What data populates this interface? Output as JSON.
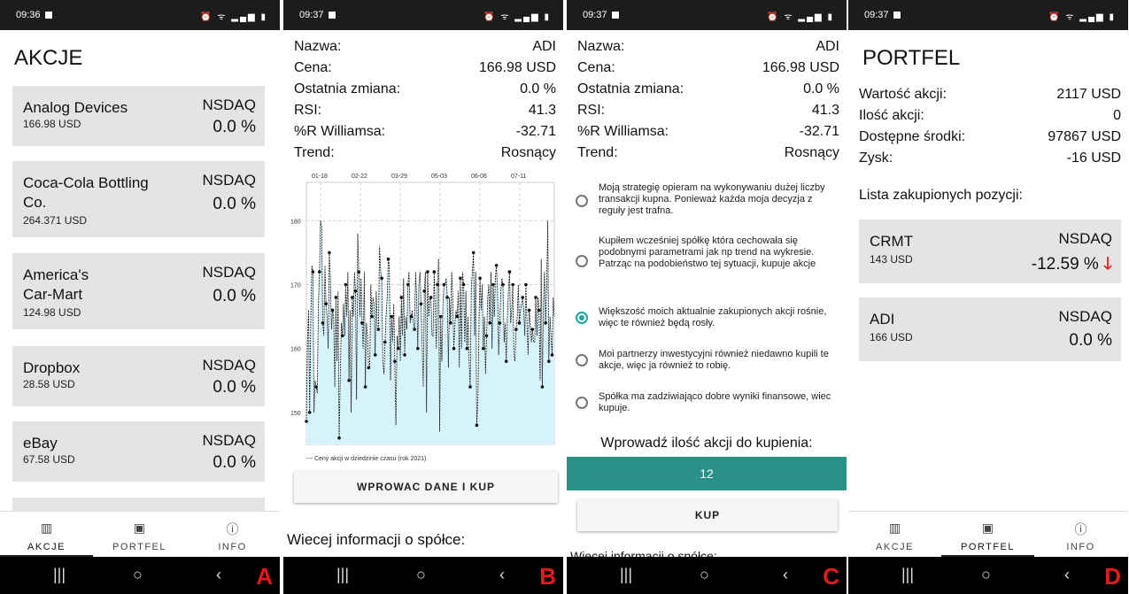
{
  "corners": [
    "A",
    "B",
    "C",
    "D"
  ],
  "status": {
    "a_time": "09:36",
    "b_time": "09:37",
    "c_time": "09:37",
    "d_time": "09:37",
    "icons": "⏰ ᯤ ▂▄▆ ▮"
  },
  "nav_icons": {
    "recent": "|||",
    "home": "○",
    "back": "‹"
  },
  "bottom_nav": [
    {
      "icon": "▥",
      "label": "AKCJE"
    },
    {
      "icon": "▣",
      "label": "PORTFEL"
    },
    {
      "icon": "ⓘ",
      "label": "INFO"
    }
  ],
  "screen_a": {
    "title": "AKCJE",
    "stocks": [
      {
        "name": "Analog Devices",
        "price": "166.98 USD",
        "exchange": "NSDAQ",
        "change": "0.0 %"
      },
      {
        "name": "Coca-Cola Bottling Co.",
        "price": "264.371 USD",
        "exchange": "NSDAQ",
        "change": "0.0 %"
      },
      {
        "name": "America's Car-Mart",
        "price": "124.98 USD",
        "exchange": "NSDAQ",
        "change": "0.0 %"
      },
      {
        "name": "Dropbox",
        "price": "28.58 USD",
        "exchange": "NSDAQ",
        "change": "0.0 %"
      },
      {
        "name": "eBay",
        "price": "67.58 USD",
        "exchange": "NSDAQ",
        "change": "0.0 %"
      }
    ]
  },
  "details": {
    "rows": [
      {
        "label": "Nazwa:",
        "value": "ADI"
      },
      {
        "label": "Cena:",
        "value": "166.98 USD"
      },
      {
        "label": "Ostatnia zmiana:",
        "value": "0.0 %"
      },
      {
        "label": "RSI:",
        "value": "41.3"
      },
      {
        "label": "%R Williamsa:",
        "value": "-32.71"
      },
      {
        "label": "Trend:",
        "value": "Rosnący"
      }
    ]
  },
  "screen_b": {
    "buy_button": "WPROWAC DANE I KUP",
    "more_info": "Wiecej informacji o spółce:"
  },
  "chart_data": {
    "type": "line",
    "x_ticks": [
      "01-18",
      "02-22",
      "03-29",
      "05-03",
      "06-06",
      "07-11"
    ],
    "y_ticks": [
      150,
      160,
      170,
      180
    ],
    "ylim": [
      145,
      186
    ],
    "legend": "--- Ceny akcji w dziedzinie czasu (rok 2021)",
    "fill_color": "#d6f3fb",
    "values": [
      148.6,
      161,
      166,
      150,
      164,
      173,
      172,
      150,
      155,
      154,
      153,
      167,
      172,
      180,
      179,
      164,
      162,
      173,
      167,
      165,
      160,
      175,
      171,
      163,
      166,
      165,
      154,
      168,
      158,
      169,
      146,
      155,
      164,
      162,
      167,
      162,
      170,
      165,
      172,
      155,
      166,
      150,
      168,
      165,
      172,
      169,
      152,
      178,
      172,
      165,
      171,
      164,
      160,
      172,
      154,
      164,
      162,
      157,
      157,
      170,
      165,
      168,
      167,
      159,
      169,
      163,
      163,
      176,
      172,
      171,
      158,
      156,
      161,
      165,
      168,
      174,
      173,
      155,
      165,
      161,
      167,
      158,
      148,
      162,
      160,
      165,
      158,
      168,
      162,
      171,
      159,
      165,
      163,
      170,
      172,
      164,
      165,
      166,
      164,
      163,
      172,
      168,
      160,
      170,
      172,
      167,
      161,
      154,
      169,
      172,
      150,
      172,
      165,
      168,
      168,
      162,
      162,
      172,
      166,
      160,
      170,
      174,
      147,
      165,
      158,
      167,
      170,
      170,
      171,
      168,
      157,
      168,
      164,
      172,
      168,
      160,
      164,
      166,
      165,
      169,
      157,
      171,
      160,
      172,
      170,
      161,
      169,
      160,
      165,
      158,
      154,
      170,
      172,
      175,
      162,
      172,
      148,
      152,
      164,
      171,
      166,
      170,
      160,
      165,
      156,
      162,
      168,
      170,
      164,
      172,
      160,
      170,
      165,
      171,
      173,
      169,
      159,
      164,
      169,
      171,
      170,
      161,
      164,
      158,
      165,
      169,
      172,
      164,
      166,
      170,
      159,
      158,
      163,
      165,
      170,
      164,
      166,
      167,
      168,
      166,
      162,
      170,
      164,
      159,
      166,
      164,
      161,
      163,
      161,
      161,
      168,
      162,
      168,
      166,
      155,
      174,
      154,
      167,
      172,
      164,
      170,
      180,
      158,
      165,
      162,
      159,
      168,
      165
    ]
  },
  "screen_c": {
    "options": [
      "Moją strategię opieram na wykonywaniu dużej liczby transakcji kupna. Ponieważ każda moja decyzja z reguły jest trafna.",
      "Kupiłem wcześniej spółkę która cechowała się podobnymi parametrami jak np trend na wykresie. Patrząc na podobieństwo tej sytuacji, kupuje akcje",
      "Większość moich aktualnie zakupionych akcji rośnie, więc te również będą rosły.",
      "Moi partnerzy inwestycyjni również niedawno kupili te akcje, więc ja również to robię.",
      "Spółka ma zadziwiająco dobre wyniki finansowe, wiec kupuje."
    ],
    "selected_index": 2,
    "qty_label": "Wprowadź ilość akcji do kupienia:",
    "qty_value": "12",
    "buy_button": "KUP",
    "cut_text": "Więcej informacji o spółce:"
  },
  "screen_d": {
    "title": "PORTFEL",
    "rows": [
      {
        "label": "Wartość akcji:",
        "value": "2117 USD"
      },
      {
        "label": "Ilość akcji:",
        "value": "0"
      },
      {
        "label": "Dostępne środki:",
        "value": "97867 USD"
      },
      {
        "label": "Zysk:",
        "value": "-16 USD"
      }
    ],
    "list_title": "Lista zakupionych pozycji:",
    "positions": [
      {
        "name": "CRMT",
        "price": "143 USD",
        "exchange": "NSDAQ",
        "change": "-12.59 %",
        "arrow": "🡓"
      },
      {
        "name": "ADI",
        "price": "166 USD",
        "exchange": "NSDAQ",
        "change": "0.0 %",
        "arrow": ""
      }
    ]
  }
}
